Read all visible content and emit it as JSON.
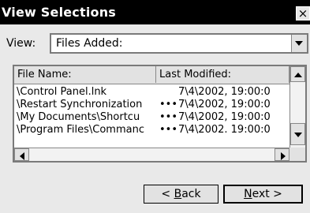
{
  "window": {
    "title": "View Selections",
    "close_label": "×"
  },
  "view_selector": {
    "label": "View:",
    "selected": "Files Added:"
  },
  "list": {
    "columns": [
      "File Name:",
      "Last Modified:"
    ],
    "rows": [
      {
        "name": "\\Control Panel.lnk",
        "ellipsis": "",
        "modified": "7\\4\\2002, 19:00:0"
      },
      {
        "name": "\\Restart Synchronization",
        "ellipsis": "•••",
        "modified": "7\\4\\2002, 19:00:0"
      },
      {
        "name": "\\My Documents\\Shortcu",
        "ellipsis": "•••",
        "modified": "7\\4\\2002, 19:00:0"
      },
      {
        "name": "\\Program Files\\Commanc",
        "ellipsis": "•••",
        "modified": "7\\4\\2002. 19:00:0"
      }
    ]
  },
  "buttons": {
    "back": {
      "prefix": "< ",
      "accel": "B",
      "rest": "ack"
    },
    "next": {
      "prefix": "",
      "accel": "N",
      "rest": "ext >"
    }
  }
}
